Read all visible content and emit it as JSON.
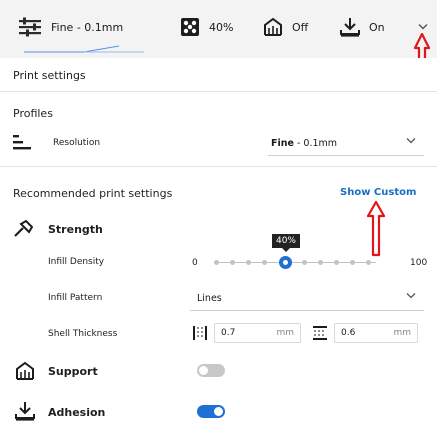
{
  "topbar": {
    "profile_label": "Fine - 0.1mm",
    "infill_label": "40%",
    "support_label": "Off",
    "adhesion_label": "On",
    "icons": [
      "sliders-icon",
      "infill-icon",
      "support-icon",
      "adhesion-icon",
      "chevron-down-icon"
    ]
  },
  "panel": {
    "title": "Print settings",
    "profiles": {
      "heading": "Profiles",
      "resolution_label": "Resolution",
      "resolution_value_bold": "Fine",
      "resolution_value_rest": " - 0.1mm"
    },
    "recommended": {
      "heading": "Recommended print settings",
      "show_custom": "Show Custom"
    },
    "strength": {
      "heading": "Strength",
      "infill_density_label": "Infill Density",
      "slider_min": "0",
      "slider_max": "100",
      "slider_value": 40,
      "slider_tooltip": "40%",
      "infill_pattern_label": "Infill Pattern",
      "infill_pattern_value": "Lines",
      "shell_thickness_label": "Shell Thickness",
      "wall_value": "0.7",
      "wall_unit": "mm",
      "topbottom_value": "0.6",
      "topbottom_unit": "mm"
    },
    "support": {
      "heading": "Support",
      "enabled": false
    },
    "adhesion": {
      "heading": "Adhesion",
      "enabled": true
    }
  },
  "colors": {
    "accent": "#1f6fd6",
    "annotation_arrow": "#e0161b",
    "toggle_off": "#c8c8c8"
  }
}
